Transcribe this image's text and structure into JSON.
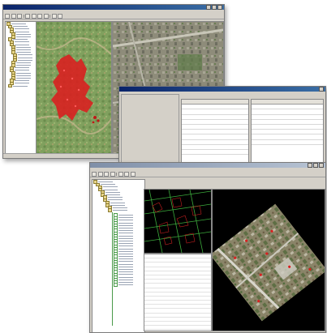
{
  "colors": {
    "titlebar_active": "#0a246a",
    "map_terrain": "#7a9a5a",
    "map_points": "#d82020",
    "vector_lines": "#3caa3c",
    "canvas_black": "#000000"
  },
  "icons": [
    "folder-icon",
    "tool-button-icon",
    "minimize-icon",
    "maximize-icon",
    "close-icon"
  ]
}
